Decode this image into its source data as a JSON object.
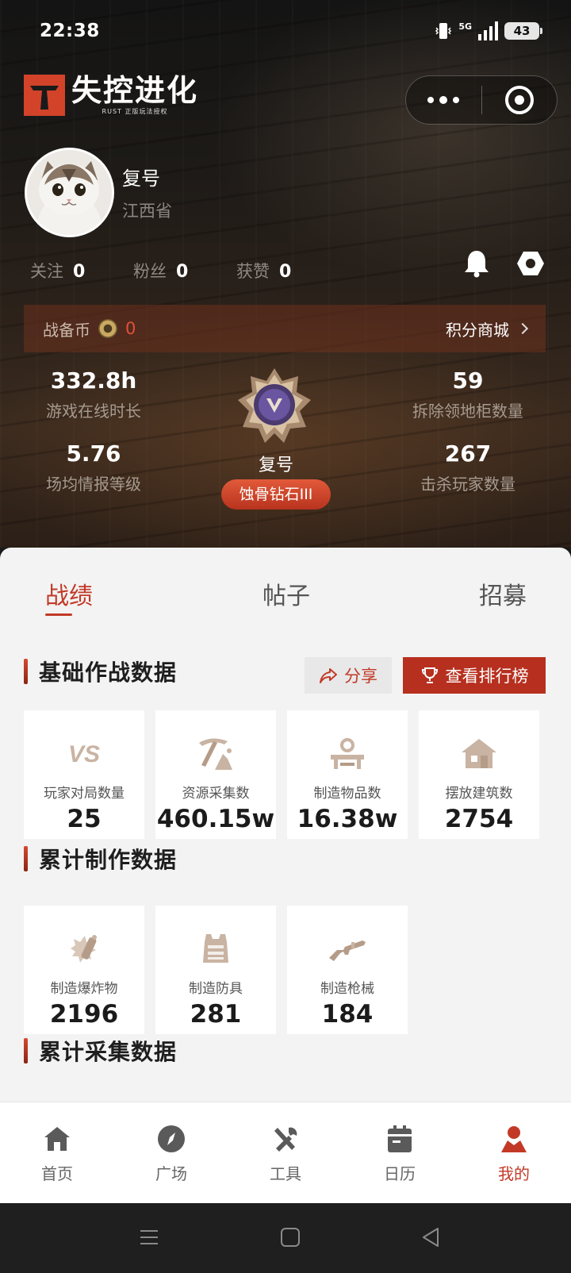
{
  "status_bar": {
    "time": "22:38",
    "network": "5G",
    "battery": "43"
  },
  "logo": {
    "title": "失控进化",
    "subtitle": "RUST 正版玩法授权"
  },
  "profile": {
    "name": "复号",
    "province": "江西省"
  },
  "social": [
    {
      "label": "关注",
      "value": "0"
    },
    {
      "label": "粉丝",
      "value": "0"
    },
    {
      "label": "获赞",
      "value": "0"
    }
  ],
  "coin": {
    "label": "战备币",
    "value": "0",
    "mall_label": "积分商城"
  },
  "stats": {
    "online_hours": {
      "value": "332.8h",
      "label": "游戏在线时长"
    },
    "cabinets_destroyed": {
      "value": "59",
      "label": "拆除领地柜数量"
    },
    "intel_level": {
      "value": "5.76",
      "label": "场均情报等级"
    },
    "kills": {
      "value": "267",
      "label": "击杀玩家数量"
    }
  },
  "rank": {
    "name": "复号",
    "tier": "蚀骨钻石III"
  },
  "tabs": [
    "战绩",
    "帖子",
    "招募"
  ],
  "sections": {
    "basic": {
      "title": "基础作战数据",
      "share_label": "分享",
      "leaderboard_label": "查看排行榜",
      "cards": [
        {
          "label": "玩家对局数量",
          "value": "25",
          "icon": "vs-icon"
        },
        {
          "label": "资源采集数",
          "value": "460.15w",
          "icon": "pickaxe-icon"
        },
        {
          "label": "制造物品数",
          "value": "16.38w",
          "icon": "workbench-icon"
        },
        {
          "label": "摆放建筑数",
          "value": "2754",
          "icon": "house-icon"
        }
      ]
    },
    "crafting": {
      "title": "累计制作数据",
      "cards": [
        {
          "label": "制造爆炸物",
          "value": "2196",
          "icon": "explosive-icon"
        },
        {
          "label": "制造防具",
          "value": "281",
          "icon": "armor-vest-icon"
        },
        {
          "label": "制造枪械",
          "value": "184",
          "icon": "rifle-icon"
        }
      ]
    },
    "gathering": {
      "title": "累计采集数据"
    }
  },
  "bottom_nav": [
    {
      "label": "首页",
      "icon": "home-icon"
    },
    {
      "label": "广场",
      "icon": "compass-icon"
    },
    {
      "label": "工具",
      "icon": "tools-icon"
    },
    {
      "label": "日历",
      "icon": "calendar-icon"
    },
    {
      "label": "我的",
      "icon": "profile-icon",
      "active": true
    }
  ],
  "colors": {
    "accent": "#c23a27",
    "brand_red": "#d2432a",
    "coin_value": "#e0503a"
  }
}
